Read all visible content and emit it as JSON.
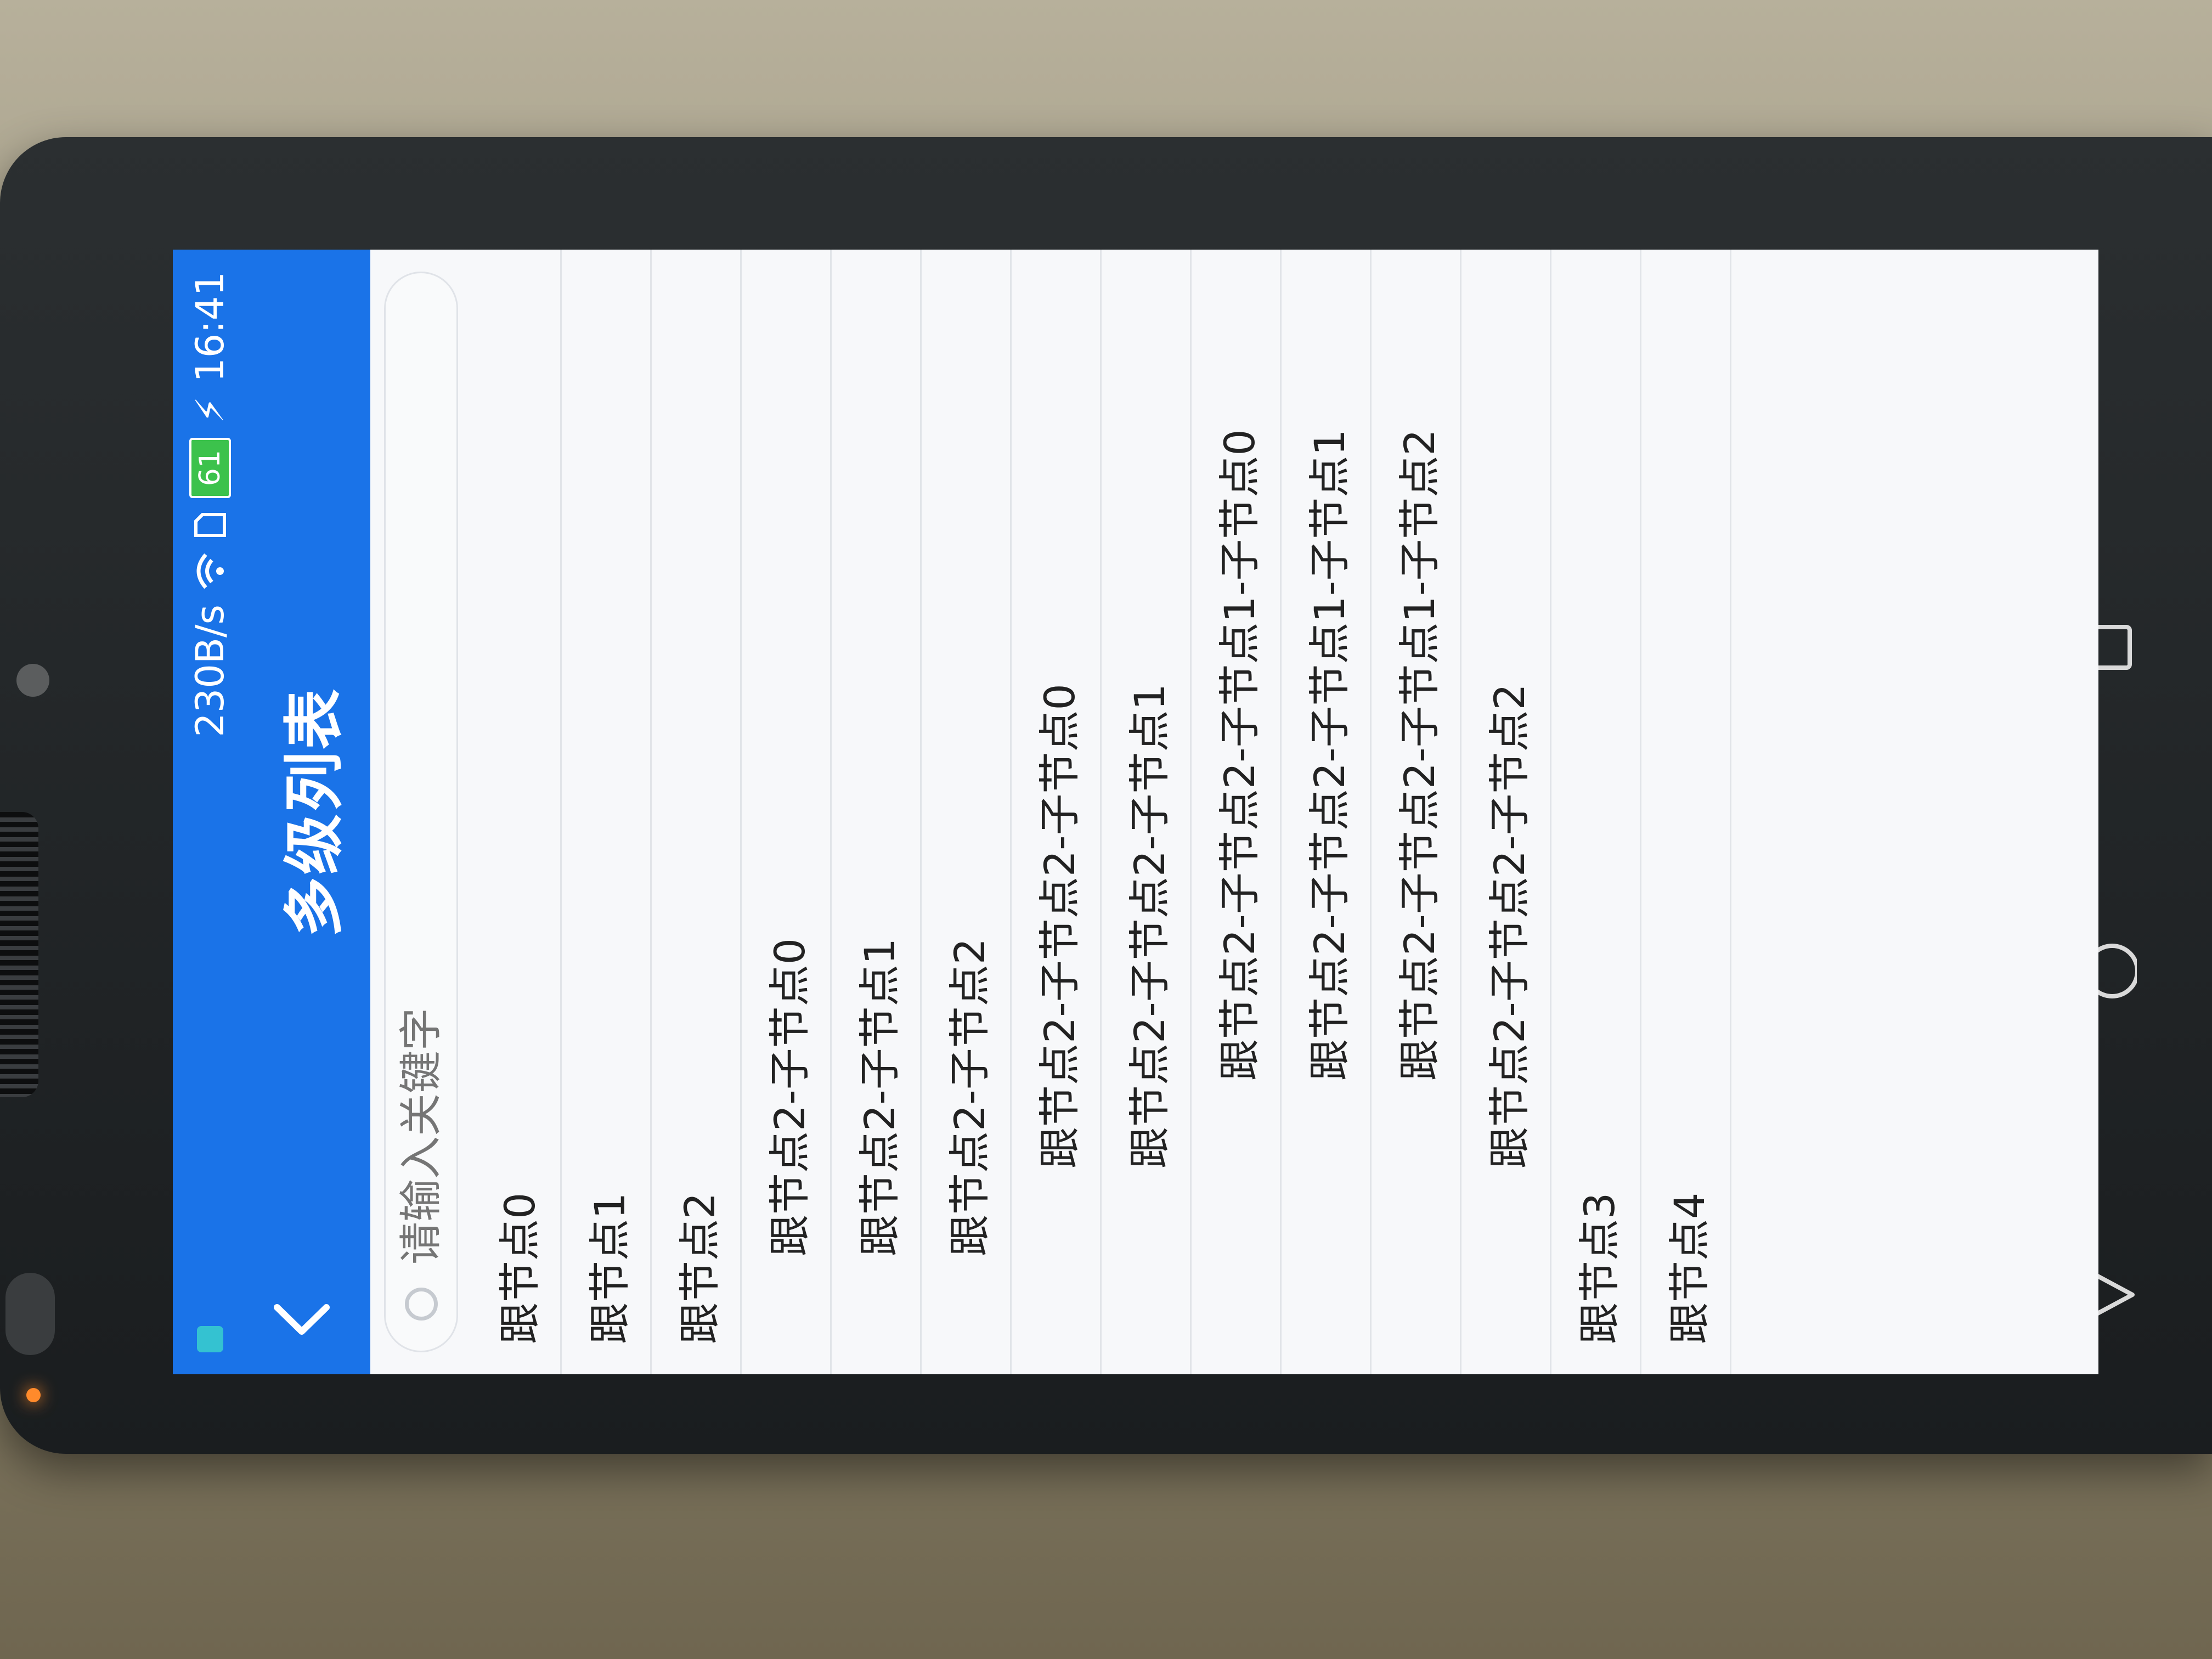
{
  "status_bar": {
    "network_speed": "230B/s",
    "battery_level": "61",
    "time": "16:41",
    "icons": [
      "sim-icon",
      "wifi-icon",
      "sim-card-icon",
      "battery-icon",
      "charging-icon"
    ]
  },
  "toolbar": {
    "title": "多级列表",
    "back_icon": "chevron-left-icon"
  },
  "search": {
    "placeholder": "请输入关键字"
  },
  "tree": {
    "rows": [
      {
        "label": "跟节点0",
        "level": 0
      },
      {
        "label": "跟节点1",
        "level": 0
      },
      {
        "label": "跟节点2",
        "level": 0
      },
      {
        "label": "跟节点2-子节点0",
        "level": 1
      },
      {
        "label": "跟节点2-子节点1",
        "level": 1
      },
      {
        "label": "跟节点2-子节点2",
        "level": 1
      },
      {
        "label": "跟节点2-子节点2-子节点0",
        "level": 2
      },
      {
        "label": "跟节点2-子节点2-子节点1",
        "level": 2
      },
      {
        "label": "跟节点2-子节点2-子节点1-子节点0",
        "level": 3
      },
      {
        "label": "跟节点2-子节点2-子节点1-子节点1",
        "level": 3
      },
      {
        "label": "跟节点2-子节点2-子节点1-子节点2",
        "level": 3
      },
      {
        "label": "跟节点2-子节点2-子节点2",
        "level": 2
      },
      {
        "label": "跟节点3",
        "level": 0
      },
      {
        "label": "跟节点4",
        "level": 0
      }
    ]
  },
  "nav_bar": {
    "icons": [
      "recents-square-icon",
      "home-circle-icon",
      "back-triangle-icon"
    ]
  },
  "colors": {
    "primary": "#1a73e8",
    "background": "#f7f8fa",
    "divider": "#e1e4e8",
    "text": "#222222"
  }
}
